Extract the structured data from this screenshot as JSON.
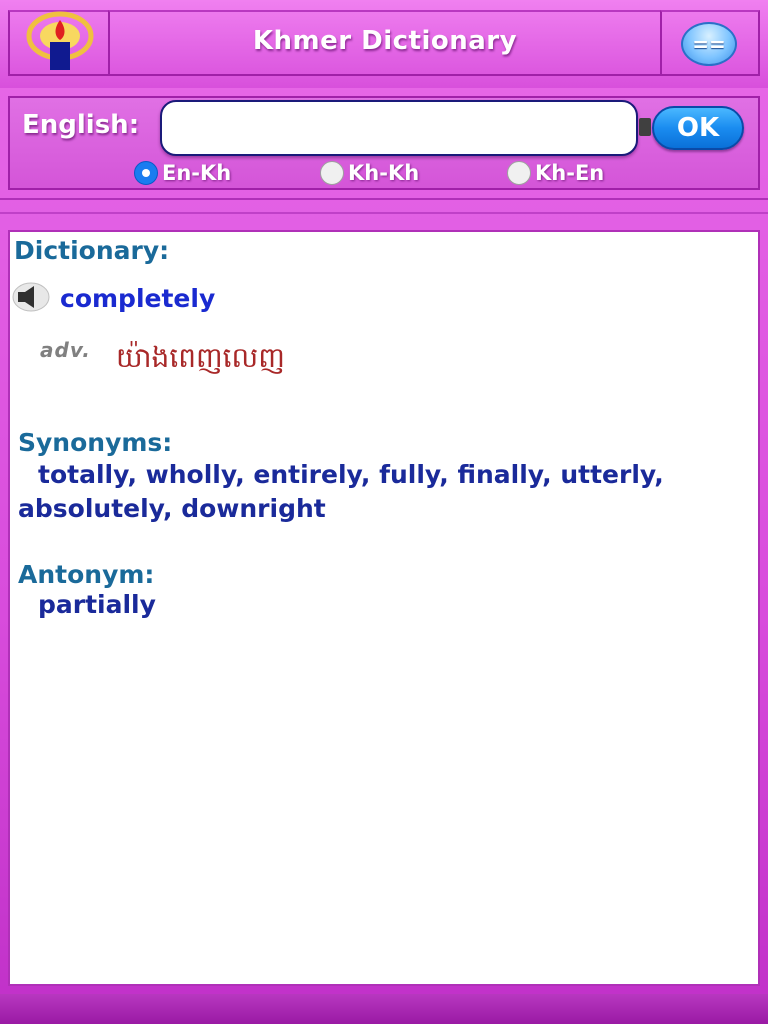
{
  "header": {
    "title": "Khmer Dictionary",
    "menu_label": "=="
  },
  "search": {
    "label": "English:",
    "value": "",
    "placeholder": "",
    "ok_label": "OK",
    "modes": [
      {
        "label": "En-Kh",
        "selected": true
      },
      {
        "label": "Kh-Kh",
        "selected": false
      },
      {
        "label": "Kh-En",
        "selected": false
      }
    ]
  },
  "entry": {
    "section_title": "Dictionary:",
    "headword": "completely",
    "pos": "adv.",
    "definition": "យ៉ាងពេញលេញ",
    "synonyms_title": "Synonyms:",
    "synonyms": "totally, wholly, entirely, fully, finally, utterly, absolutely, downright",
    "antonyms_title": "Antonym:",
    "antonyms": "partially"
  },
  "colors": {
    "background": "#d84cdc",
    "heading": "#1a6a9a",
    "headword": "#1a2ad0",
    "definition": "#a82828",
    "synonym_text": "#1a2a9a",
    "ok_button": "#1a8cf0"
  },
  "icons": {
    "logo": "candle-logo-icon",
    "speaker": "speaker-icon"
  }
}
